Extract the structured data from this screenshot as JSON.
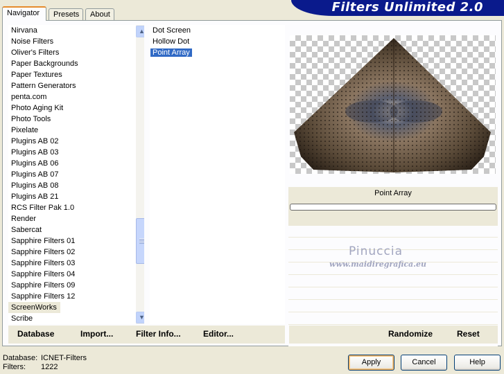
{
  "tabs": [
    {
      "label": "Navigator",
      "active": true
    },
    {
      "label": "Presets",
      "active": false
    },
    {
      "label": "About",
      "active": false
    }
  ],
  "app_title": "Filters Unlimited 2.0",
  "categories": [
    "Nirvana",
    "Noise Filters",
    "Oliver's Filters",
    "Paper Backgrounds",
    "Paper Textures",
    "Pattern Generators",
    "penta.com",
    "Photo Aging Kit",
    "Photo Tools",
    "Pixelate",
    "Plugins AB 02",
    "Plugins AB 03",
    "Plugins AB 06",
    "Plugins AB 07",
    "Plugins AB 08",
    "Plugins AB 21",
    "RCS Filter Pak 1.0",
    "Render",
    "Sabercat",
    "Sapphire Filters 01",
    "Sapphire Filters 02",
    "Sapphire Filters 03",
    "Sapphire Filters 04",
    "Sapphire Filters 09",
    "Sapphire Filters 12",
    "ScreenWorks",
    "Scribe"
  ],
  "selected_category": "ScreenWorks",
  "filters": [
    "Dot Screen",
    "Hollow Dot",
    "Point Array"
  ],
  "selected_filter": "Point Array",
  "preview_filter_name": "Point Array",
  "progress": 0,
  "watermark": {
    "name": "Pinuccia",
    "site": "www.maidiregrafica.eu"
  },
  "bottom_left_buttons": {
    "database": "Database",
    "import": "Import...",
    "filter_info": "Filter Info...",
    "editor": "Editor..."
  },
  "bottom_right_buttons": {
    "randomize": "Randomize",
    "reset": "Reset"
  },
  "status": {
    "database_label": "Database:",
    "database_value": "ICNET-Filters",
    "filters_label": "Filters:",
    "filters_value": "1222"
  },
  "dialog_buttons": {
    "apply": "Apply",
    "cancel": "Cancel",
    "help": "Help"
  },
  "colors": {
    "banner": "#0a1a8c",
    "selection": "#316ac5",
    "face": "#ece9d8"
  }
}
